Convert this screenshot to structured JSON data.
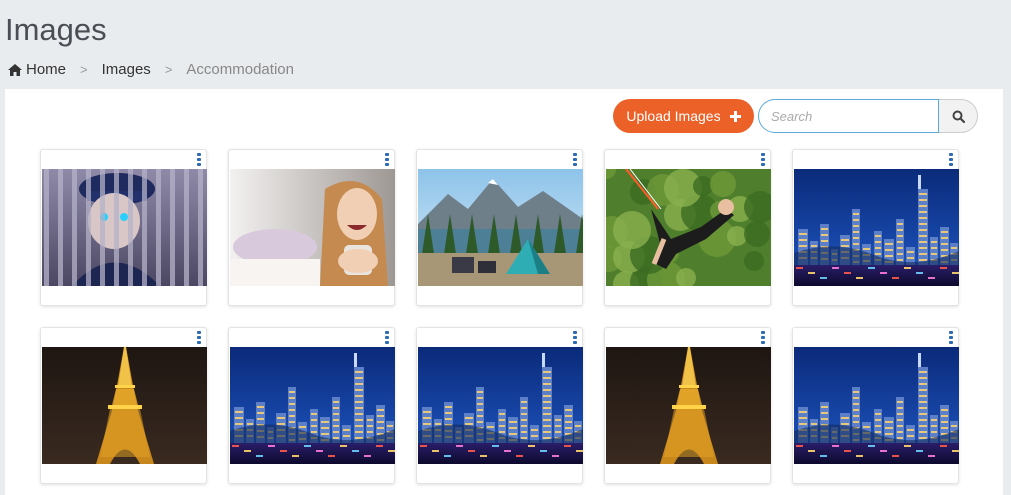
{
  "page": {
    "title": "Images"
  },
  "breadcrumb": [
    {
      "label": "Home",
      "icon": "home-icon"
    },
    {
      "label": "Images"
    },
    {
      "label": "Accommodation"
    }
  ],
  "toolbar": {
    "upload_label": "Upload Images",
    "upload_color": "#ec6127",
    "search_placeholder": "Search"
  },
  "gallery": {
    "images": [
      {
        "kind": "anime"
      },
      {
        "kind": "woman"
      },
      {
        "kind": "camping"
      },
      {
        "kind": "bungee"
      },
      {
        "kind": "hongkong"
      },
      {
        "kind": "eiffel"
      },
      {
        "kind": "hongkong"
      },
      {
        "kind": "hongkong"
      },
      {
        "kind": "eiffel"
      },
      {
        "kind": "hongkong"
      }
    ]
  }
}
